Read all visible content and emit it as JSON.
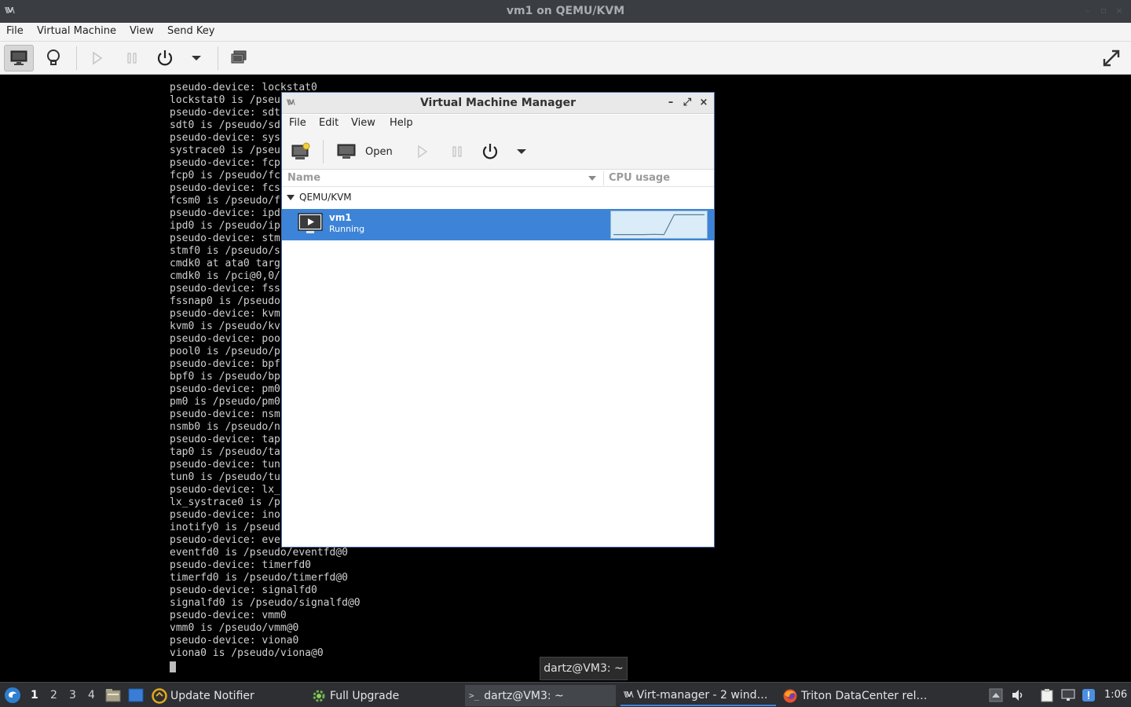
{
  "outer_window": {
    "title": "vm1 on QEMU/KVM",
    "menu": [
      "File",
      "Virtual Machine",
      "View",
      "Send Key"
    ]
  },
  "console_lines": [
    "pseudo-device: lockstat0",
    "lockstat0 is /pseu",
    "pseudo-device: sdt",
    "sdt0 is /pseudo/sd",
    "pseudo-device: sys",
    "systrace0 is /pseu",
    "pseudo-device: fcp",
    "fcp0 is /pseudo/fc",
    "pseudo-device: fcs",
    "fcsm0 is /pseudo/f",
    "pseudo-device: ipd",
    "ipd0 is /pseudo/ip",
    "pseudo-device: stm",
    "stmf0 is /pseudo/s",
    "cmdk0 at ata0 targ",
    "cmdk0 is /pci@0,0/",
    "pseudo-device: fss",
    "fssnap0 is /pseudo",
    "pseudo-device: kvm",
    "kvm0 is /pseudo/kv",
    "pseudo-device: poo",
    "pool0 is /pseudo/p",
    "pseudo-device: bpf",
    "bpf0 is /pseudo/bp",
    "pseudo-device: pm0",
    "pm0 is /pseudo/pm0",
    "pseudo-device: nsm",
    "nsmb0 is /pseudo/n",
    "pseudo-device: tap",
    "tap0 is /pseudo/ta",
    "pseudo-device: tun",
    "tun0 is /pseudo/tu",
    "pseudo-device: lx_",
    "lx_systrace0 is /p",
    "pseudo-device: ino",
    "inotify0 is /pseud",
    "pseudo-device: eve",
    "eventfd0 is /pseudo/eventfd@0",
    "pseudo-device: timerfd0",
    "timerfd0 is /pseudo/timerfd@0",
    "pseudo-device: signalfd0",
    "signalfd0 is /pseudo/signalfd@0",
    "pseudo-device: vmm0",
    "vmm0 is /pseudo/vmm@0",
    "pseudo-device: viona0",
    "viona0 is /pseudo/viona@0"
  ],
  "vmm_window": {
    "title": "Virtual Machine Manager",
    "menu": [
      "File",
      "Edit",
      "View",
      "Help"
    ],
    "toolbar": {
      "open_label": "Open"
    },
    "columns": {
      "name": "Name",
      "cpu": "CPU usage"
    },
    "group": "QEMU/KVM",
    "vm": {
      "name": "vm1",
      "status": "Running",
      "cpu_usage_trend": [
        0.05,
        0.05,
        0.05,
        0.05,
        0.06,
        0.05,
        0.95,
        0.95,
        0.95,
        0.95
      ]
    }
  },
  "tooltip": "dartz@VM3: ~",
  "taskbar": {
    "workspaces": [
      "1",
      "2",
      "3",
      "4"
    ],
    "tasks": {
      "update_notifier": "Update Notifier",
      "full_upgrade": "Full Upgrade",
      "terminal": "dartz@VM3: ~",
      "virt_manager": "Virt-manager - 2 wind…",
      "firefox": "Triton DataCenter rel…"
    },
    "clock": "1:06"
  },
  "colors": {
    "selection": "#3d84d8",
    "taskbar": "#2d2f33"
  }
}
